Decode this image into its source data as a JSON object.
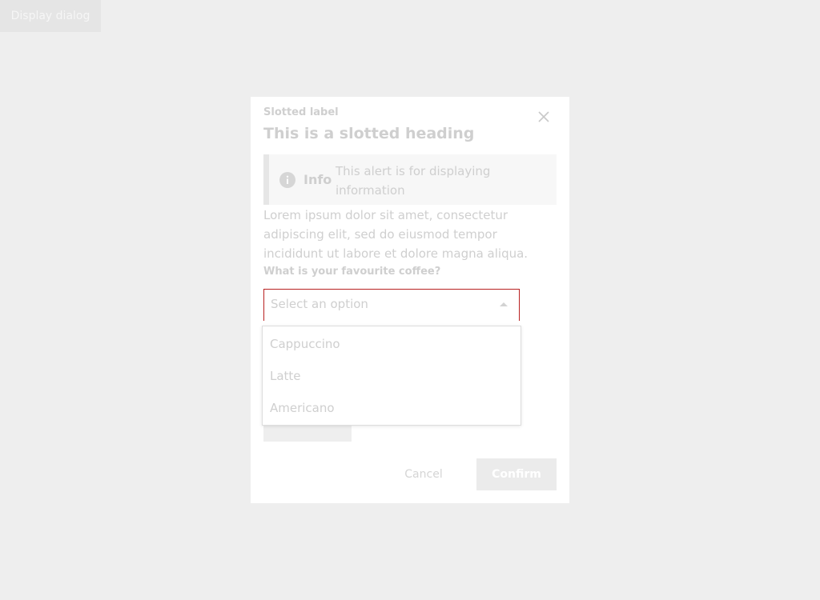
{
  "page": {
    "display_button_label": "Display dialog"
  },
  "dialog": {
    "label": "Slotted label",
    "heading": "This is a slotted heading",
    "alert": {
      "title": "Info",
      "text": "This alert is for displaying information"
    },
    "body": "Lorem ipsum dolor sit amet, consectetur adipiscing elit, sed do eiusmod tempor incididunt ut labore et dolore magna aliqua.",
    "field_label": "What is your favourite coffee?",
    "select": {
      "placeholder": "Select an option",
      "options": [
        "Cappuccino",
        "Latte",
        "Americano"
      ]
    },
    "cancel_label": "Cancel",
    "confirm_label": "Confirm"
  },
  "colors": {
    "page_background": "#eeeeee",
    "select_error_border": "#b82020"
  },
  "icons": {
    "close": "close-icon",
    "info": "info-icon",
    "select_arrow": "chevron-up-icon"
  }
}
